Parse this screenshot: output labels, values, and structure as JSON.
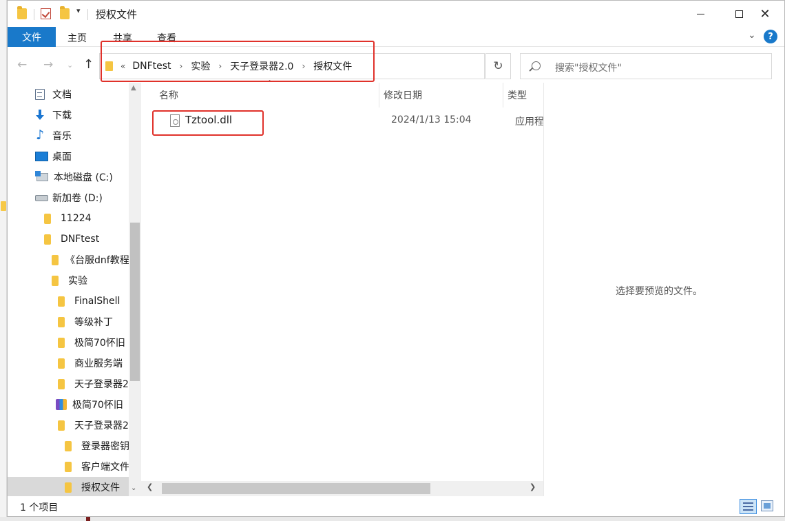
{
  "window": {
    "title": "授权文件"
  },
  "ribbon": {
    "tabs": [
      {
        "label": "文件",
        "active": true
      },
      {
        "label": "主页"
      },
      {
        "label": "共享"
      },
      {
        "label": "查看"
      }
    ],
    "help": "?"
  },
  "address": {
    "prefix": "«",
    "crumbs": [
      "DNFtest",
      "实验",
      "天子登录器2.0",
      "授权文件"
    ]
  },
  "search": {
    "placeholder": "搜索\"授权文件\""
  },
  "nav_tree": [
    {
      "label": "文档",
      "icon": "document-icon"
    },
    {
      "label": "下载",
      "icon": "download-arrow-icon"
    },
    {
      "label": "音乐",
      "icon": "music-note-icon"
    },
    {
      "label": "桌面",
      "icon": "desktop-icon"
    },
    {
      "label": "本地磁盘 (C:)",
      "icon": "system-drive-icon"
    },
    {
      "label": "新加卷 (D:)",
      "icon": "drive-icon"
    },
    {
      "label": "11224",
      "icon": "folder-icon"
    },
    {
      "label": "DNFtest",
      "icon": "folder-icon"
    },
    {
      "label": "《台服dnf教程",
      "icon": "folder-icon"
    },
    {
      "label": "实验",
      "icon": "folder-icon"
    },
    {
      "label": "FinalShell",
      "icon": "folder-icon"
    },
    {
      "label": "等级补丁",
      "icon": "folder-icon"
    },
    {
      "label": "极简70怀旧",
      "icon": "folder-icon"
    },
    {
      "label": "商业服务端",
      "icon": "folder-icon"
    },
    {
      "label": "天子登录器2",
      "icon": "folder-icon"
    },
    {
      "label": "极简70怀旧",
      "icon": "archive-icon"
    },
    {
      "label": "天子登录器2",
      "icon": "folder-icon"
    },
    {
      "label": "登录器密钥",
      "icon": "folder-icon"
    },
    {
      "label": "客户端文件",
      "icon": "folder-icon"
    },
    {
      "label": "授权文件",
      "icon": "folder-icon",
      "selected": true
    }
  ],
  "columns": {
    "name": "名称",
    "modified": "修改日期",
    "type": "类型"
  },
  "files": [
    {
      "name": "Tztool.dll",
      "modified": "2024/1/13 15:04",
      "type": "应用程序扩展",
      "icon": "dll-file-icon"
    }
  ],
  "preview": {
    "message": "选择要预览的文件。"
  },
  "status": {
    "count": "1 个项目"
  },
  "colors": {
    "accent": "#1979ca",
    "annotation": "#e0312a",
    "folder": "#f5c542"
  }
}
